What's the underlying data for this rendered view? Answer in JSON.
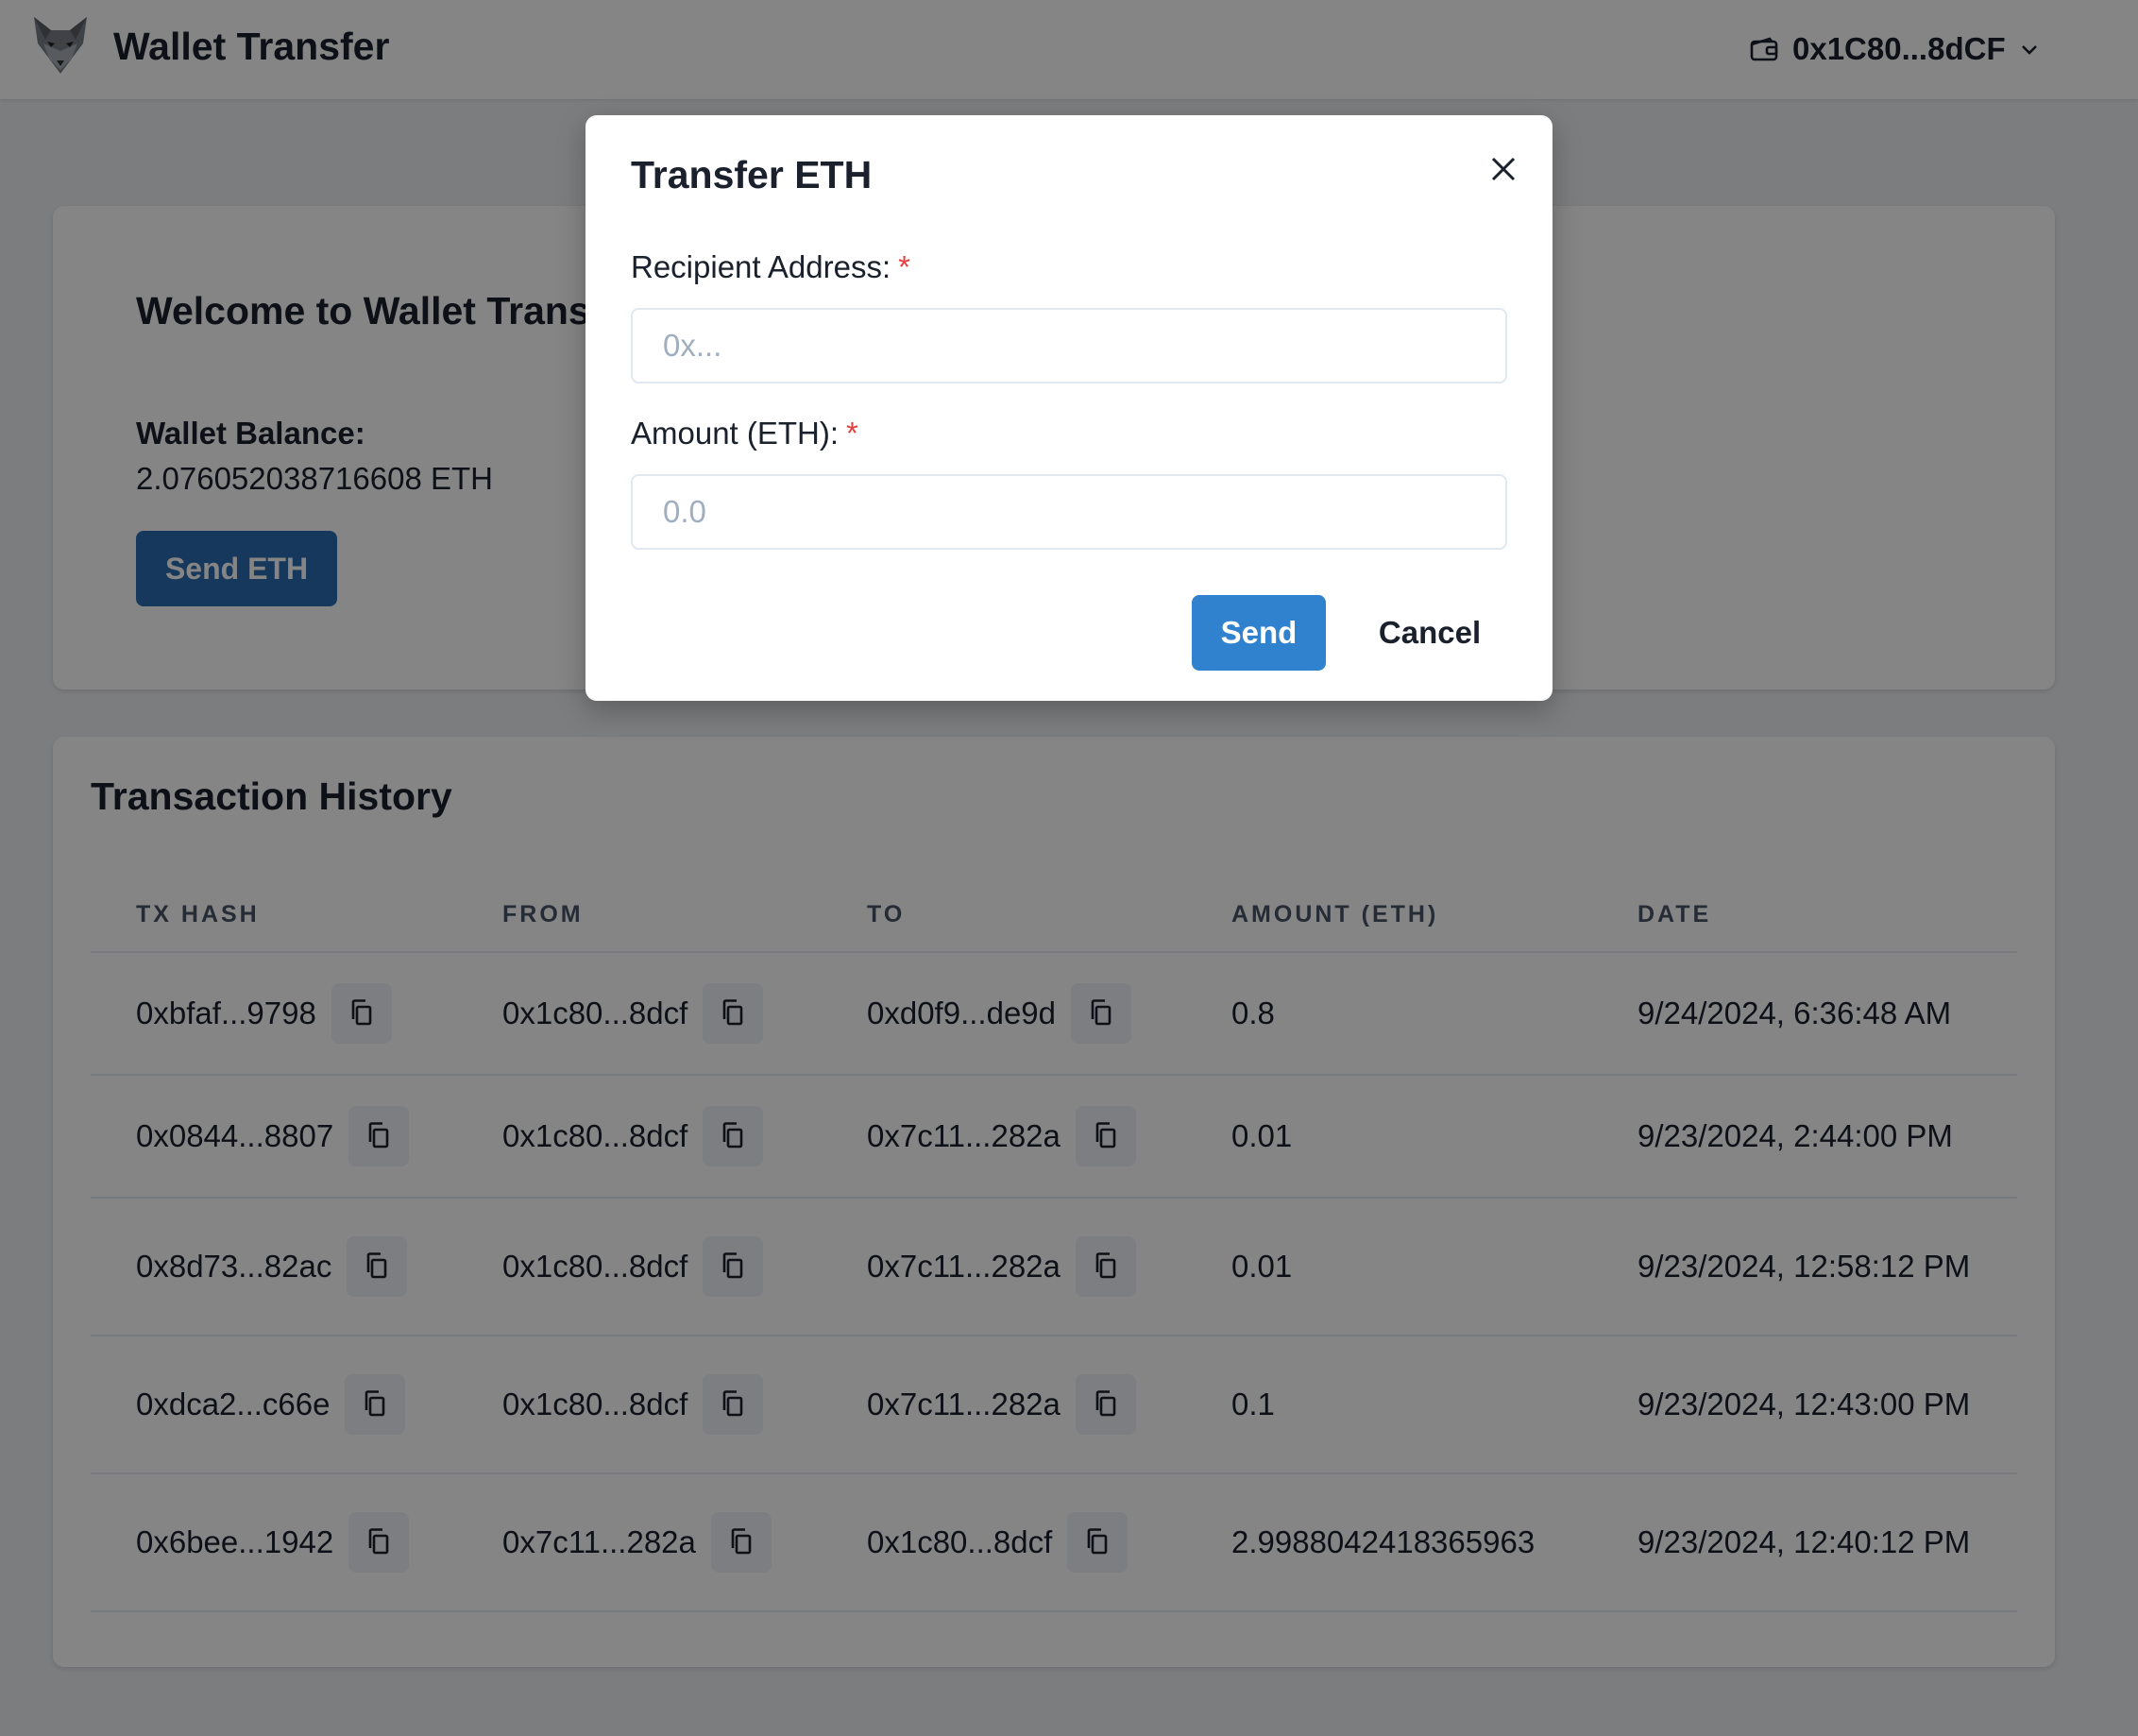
{
  "header": {
    "title": "Wallet Transfer",
    "logo_icon": "fox-logo-icon",
    "account_icon": "wallet-icon",
    "account_address": "0x1C80...8dCF",
    "account_chevron_icon": "chevron-down-icon"
  },
  "welcome": {
    "title": "Welcome to Wallet Transfer",
    "balance_label": "Wallet Balance:",
    "balance_value": "2.076052038716608 ETH",
    "send_button": "Send ETH"
  },
  "history": {
    "title": "Transaction History",
    "columns": [
      "TX HASH",
      "FROM",
      "TO",
      "AMOUNT (ETH)",
      "DATE"
    ],
    "copy_icon": "copy-icon",
    "rows": [
      {
        "hash": "0xbfaf...9798",
        "from": "0x1c80...8dcf",
        "to": "0xd0f9...de9d",
        "amount": "0.8",
        "date": "9/24/2024, 6:36:48 AM"
      },
      {
        "hash": "0x0844...8807",
        "from": "0x1c80...8dcf",
        "to": "0x7c11...282a",
        "amount": "0.01",
        "date": "9/23/2024, 2:44:00 PM"
      },
      {
        "hash": "0x8d73...82ac",
        "from": "0x1c80...8dcf",
        "to": "0x7c11...282a",
        "amount": "0.01",
        "date": "9/23/2024, 12:58:12 PM"
      },
      {
        "hash": "0xdca2...c66e",
        "from": "0x1c80...8dcf",
        "to": "0x7c11...282a",
        "amount": "0.1",
        "date": "9/23/2024, 12:43:00 PM"
      },
      {
        "hash": "0x6bee...1942",
        "from": "0x7c11...282a",
        "to": "0x1c80...8dcf",
        "amount": "2.9988042418365963",
        "date": "9/23/2024, 12:40:12 PM"
      }
    ]
  },
  "modal": {
    "title": "Transfer ETH",
    "close_icon": "close-icon",
    "recipient_label": "Recipient Address:",
    "recipient_placeholder": "0x...",
    "recipient_value": "",
    "amount_label": "Amount (ETH):",
    "amount_placeholder": "0.0",
    "amount_value": "",
    "required_mark": "*",
    "send_button": "Send",
    "cancel_button": "Cancel"
  },
  "colors": {
    "primary": "#3182ce",
    "primary_dark": "#2b6cb0",
    "required": "#e53e3e",
    "overlay": "rgba(0,0,0,0.48)"
  }
}
